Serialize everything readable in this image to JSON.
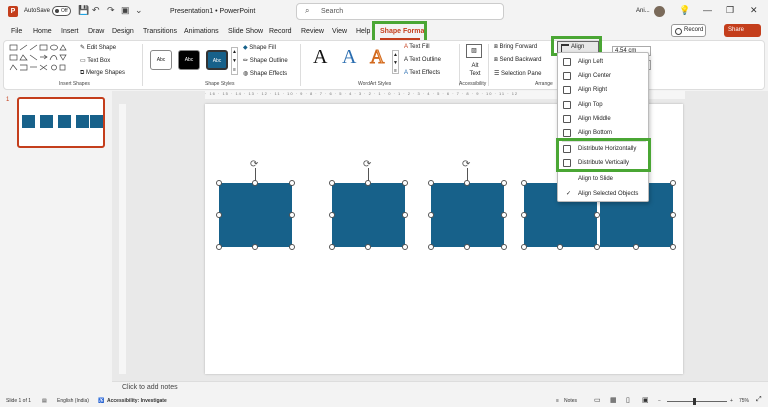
{
  "titlebar": {
    "autosave_label": "AutoSave",
    "autosave_state": "Off",
    "doc_title": "Presentation1 • PowerPoint",
    "search_placeholder": "Search",
    "user_name": "Ani...",
    "minimize": "—",
    "restore": "❐",
    "close": "✕"
  },
  "tabs": [
    "File",
    "Home",
    "Insert",
    "Draw",
    "Design",
    "Transitions",
    "Animations",
    "Slide Show",
    "Record",
    "Review",
    "View",
    "Help",
    "Shape Format"
  ],
  "ribbon_right": {
    "record": "Record",
    "share": "Share"
  },
  "ribbon": {
    "edit_shape": "Edit Shape",
    "text_box": "Text Box",
    "merge_shapes": "Merge Shapes",
    "insert_shapes_label": "Insert Shapes",
    "style_sample": "Abc",
    "shape_fill": "Shape Fill",
    "shape_outline": "Shape Outline",
    "shape_effects": "Shape Effects",
    "shape_styles_label": "Shape Styles",
    "text_fill": "Text Fill",
    "text_outline": "Text Outline",
    "text_effects": "Text Effects",
    "wordart_letter": "A",
    "wordart_label": "WordArt Styles",
    "alt_text": "Alt Text",
    "accessibility_label": "Accessibility",
    "bring_forward": "Bring Forward",
    "send_backward": "Send Backward",
    "selection_pane": "Selection Pane",
    "arrange_label": "Arrange",
    "align": "Align",
    "height_value": "4.54 cm"
  },
  "align_menu": {
    "items": [
      "Align Left",
      "Align Center",
      "Align Right",
      "Align Top",
      "Align Middle",
      "Align Bottom",
      "Distribute Horizontally",
      "Distribute Vertically",
      "Align to Slide",
      "Align Selected Objects"
    ],
    "checkmark": "✓"
  },
  "ruler_h": "· 16 · 15 · 14 · 13 · 12 · 11 · 10 · 9 · 8 · 7 · 6 · 5 · 4 · 3 · 2 · 1 · 0 · 1 · 2 · 3 · 4 · 5 · 6 · 7 · 8 · 9 · 10 · 11 · 12",
  "thumbnail": {
    "slide_number": "1"
  },
  "notes_placeholder": "Click to add notes",
  "status": {
    "slide_info": "Slide 1 of 1",
    "language": "English (India)",
    "accessibility": "Accessibility: Investigate",
    "notes": "Notes",
    "zoom": "75%"
  },
  "colors": {
    "accent": "#c43e1c",
    "shape_fill": "#17618a",
    "highlight": "#4aa634"
  }
}
